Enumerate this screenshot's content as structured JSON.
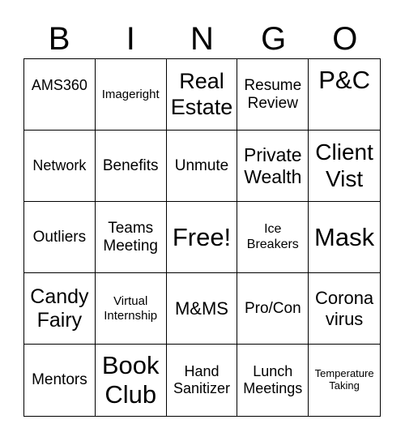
{
  "header": [
    "B",
    "I",
    "N",
    "G",
    "O"
  ],
  "cells": [
    [
      "AMS360",
      "Imageright",
      "Real Estate",
      "Resume Review",
      "P&C"
    ],
    [
      "Network",
      "Benefits",
      "Unmute",
      "Private Wealth",
      "Client Vist"
    ],
    [
      "Outliers",
      "Teams Meeting",
      "Free!",
      "Ice Breakers",
      "Mask"
    ],
    [
      "Candy Fairy",
      "Virtual Internship",
      "M&MS",
      "Pro/Con",
      "Corona virus"
    ],
    [
      "Mentors",
      "Book Club",
      "Hand Sanitizer",
      "Lunch Meetings",
      "Temperature Taking"
    ]
  ]
}
